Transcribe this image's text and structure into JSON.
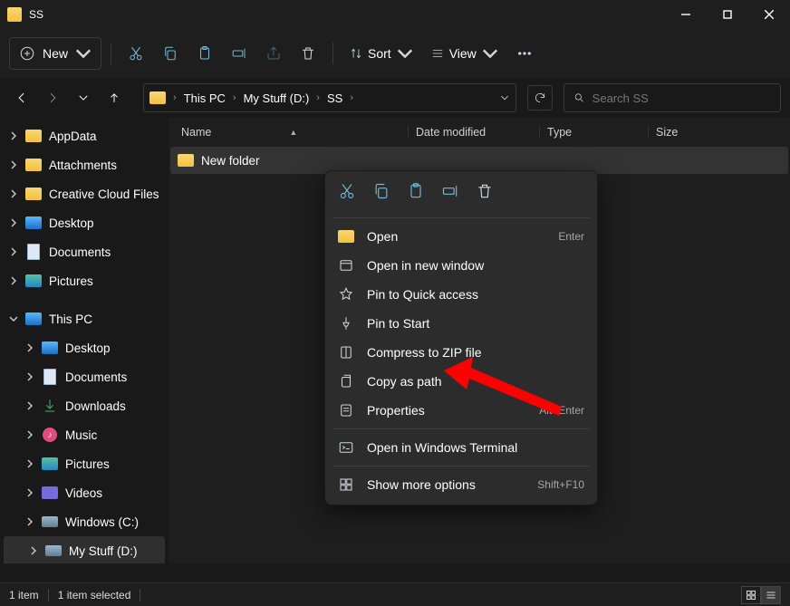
{
  "window": {
    "title": "SS"
  },
  "toolbar": {
    "new_label": "New",
    "sort_label": "Sort",
    "view_label": "View"
  },
  "breadcrumbs": {
    "root": "This PC",
    "drive": "My Stuff (D:)",
    "folder": "SS"
  },
  "search": {
    "placeholder": "Search SS"
  },
  "columns": {
    "name": "Name",
    "date": "Date modified",
    "type": "Type",
    "size": "Size"
  },
  "rows": {
    "item0": {
      "name": "New folder"
    }
  },
  "sidebar": {
    "appdata": "AppData",
    "attachments": "Attachments",
    "creative": "Creative Cloud Files",
    "desktop": "Desktop",
    "documents": "Documents",
    "pictures": "Pictures",
    "thispc": "This PC",
    "tp_desktop": "Desktop",
    "tp_documents": "Documents",
    "tp_downloads": "Downloads",
    "tp_music": "Music",
    "tp_pictures": "Pictures",
    "tp_videos": "Videos",
    "tp_c": "Windows (C:)",
    "tp_d": "My Stuff (D:)"
  },
  "context": {
    "open": "Open",
    "open_accel": "Enter",
    "open_new_window": "Open in new window",
    "pin_quick": "Pin to Quick access",
    "pin_start": "Pin to Start",
    "compress": "Compress to ZIP file",
    "copy_path": "Copy as path",
    "properties": "Properties",
    "properties_accel": "Alt+Enter",
    "open_terminal": "Open in Windows Terminal",
    "show_more": "Show more options",
    "show_more_accel": "Shift+F10"
  },
  "status": {
    "count": "1 item",
    "selected": "1 item selected"
  }
}
